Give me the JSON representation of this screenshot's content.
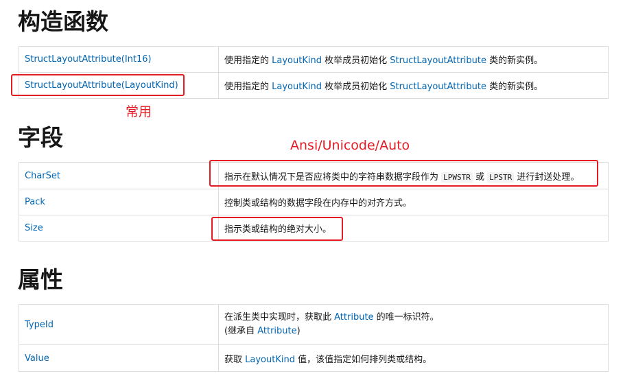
{
  "constructors": {
    "title": "构造函数",
    "rows": [
      {
        "name": "StructLayoutAttribute(Int16)",
        "desc": [
          "使用指定的 ",
          "LayoutKind",
          " 枚举成员初始化 ",
          "StructLayoutAttribute",
          " 类的新实例。"
        ]
      },
      {
        "name": "StructLayoutAttribute(LayoutKind)",
        "desc": [
          "使用指定的 ",
          "LayoutKind",
          " 枚举成员初始化 ",
          "StructLayoutAttribute",
          " 类的新实例。"
        ]
      }
    ]
  },
  "fields": {
    "title": "字段",
    "rows": [
      {
        "name": "CharSet",
        "desc": [
          "指示在默认情况下是否应将类中的字符串数据字段作为 ",
          "LPWSTR",
          " 或 ",
          "LPSTR",
          " 进行封送处理。"
        ]
      },
      {
        "name": "Pack",
        "desc": "控制类或结构的数据字段在内存中的对齐方式。"
      },
      {
        "name": "Size",
        "desc": "指示类或结构的绝对大小。"
      }
    ]
  },
  "properties": {
    "title": "属性",
    "rows": [
      {
        "name": "TypeId",
        "desc": [
          "在派生类中实现时，获取此 ",
          "Attribute",
          " 的唯一标识符。"
        ],
        "inherited": [
          "(继承自 ",
          "Attribute",
          ")"
        ]
      },
      {
        "name": "Value",
        "desc": [
          "获取 ",
          "LayoutKind",
          " 值，该值指定如何排列类或结构。"
        ]
      }
    ]
  },
  "annotations": {
    "common_label": "常用",
    "charset_label": "Ansi/Unicode/Auto",
    "color": "#e51b24"
  }
}
